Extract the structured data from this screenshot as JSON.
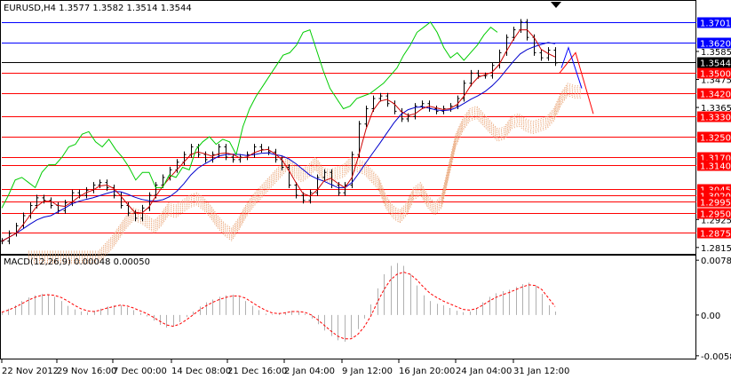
{
  "chart_data": [
    {
      "type": "candlestick",
      "title": "EURUSD,H4  1.3577 1.3582 1.3514 1.3544",
      "ylim": [
        1.279,
        1.378
      ],
      "y_ticks": [
        "1.3585",
        "1.3475",
        "1.3365",
        "1.2925",
        "1.2815"
      ],
      "levels": [
        {
          "label": "1.3701",
          "value": 1.3701,
          "color": "#0000ff",
          "box": "#0000ff"
        },
        {
          "label": "1.3620",
          "value": 1.362,
          "color": "#0000ff",
          "box": "#0000ff"
        },
        {
          "label": "1.3544",
          "value": 1.3544,
          "color": "#000000",
          "box": "#000000"
        },
        {
          "label": "1.3500",
          "value": 1.35,
          "color": "#ff0000",
          "box": "#ff0000"
        },
        {
          "label": "1.3420",
          "value": 1.342,
          "color": "#ff0000",
          "box": "#ff0000"
        },
        {
          "label": "1.3330",
          "value": 1.333,
          "color": "#ff0000",
          "box": "#ff0000"
        },
        {
          "label": "1.3250",
          "value": 1.325,
          "color": "#ff0000",
          "box": "#ff0000"
        },
        {
          "label": "1.3170",
          "value": 1.317,
          "color": "#ff0000",
          "box": "#ff0000"
        },
        {
          "label": "1.3140",
          "value": 1.314,
          "color": "#ff0000",
          "box": "#ff0000"
        },
        {
          "label": "1.3045",
          "value": 1.3045,
          "color": "#ff0000",
          "box": "#ff0000"
        },
        {
          "label": "1.3020",
          "value": 1.302,
          "color": "#ff0000",
          "box": "#ff0000"
        },
        {
          "label": "1.2995",
          "value": 1.2995,
          "color": "#ff0000",
          "box": "#ff0000"
        },
        {
          "label": "1.2950",
          "value": 1.295,
          "color": "#ff0000",
          "box": "#ff0000"
        },
        {
          "label": "1.2875",
          "value": 1.2875,
          "color": "#ff0000",
          "box": "#ff0000"
        }
      ],
      "close_series": [
        1.284,
        1.287,
        1.29,
        1.294,
        1.298,
        1.301,
        1.3,
        1.298,
        1.296,
        1.299,
        1.303,
        1.302,
        1.304,
        1.306,
        1.307,
        1.305,
        1.302,
        1.298,
        1.295,
        1.293,
        1.297,
        1.302,
        1.306,
        1.309,
        1.312,
        1.315,
        1.318,
        1.321,
        1.318,
        1.316,
        1.318,
        1.321,
        1.317,
        1.316,
        1.317,
        1.318,
        1.321,
        1.32,
        1.319,
        1.316,
        1.313,
        1.306,
        1.302,
        1.3,
        1.303,
        1.309,
        1.311,
        1.306,
        1.303,
        1.306,
        1.318,
        1.33,
        1.336,
        1.34,
        1.341,
        1.338,
        1.335,
        1.332,
        1.333,
        1.337,
        1.338,
        1.336,
        1.335,
        1.336,
        1.337,
        1.34,
        1.346,
        1.35,
        1.349,
        1.349,
        1.353,
        1.358,
        1.364,
        1.367,
        1.37,
        1.364,
        1.358,
        1.356,
        1.359,
        1.354
      ],
      "lagging_series": [
        1.297,
        1.302,
        1.308,
        1.309,
        1.307,
        1.305,
        1.311,
        1.314,
        1.314,
        1.317,
        1.321,
        1.322,
        1.326,
        1.327,
        1.323,
        1.321,
        1.324,
        1.32,
        1.317,
        1.313,
        1.308,
        1.311,
        1.311,
        1.305,
        1.305,
        1.31,
        1.309,
        1.313,
        1.312,
        1.32,
        1.323,
        1.325,
        1.322,
        1.324,
        1.323,
        1.318,
        1.329,
        1.336,
        1.341,
        1.345,
        1.349,
        1.353,
        1.357,
        1.358,
        1.361,
        1.366,
        1.367,
        1.359,
        1.351,
        1.344,
        1.34,
        1.336,
        1.337,
        1.34,
        1.341,
        1.342,
        1.344,
        1.346,
        1.349,
        1.352,
        1.357,
        1.361,
        1.366,
        1.368,
        1.37,
        1.366,
        1.36,
        1.356,
        1.358,
        1.355,
        1.358,
        1.361,
        1.365,
        1.368,
        1.366
      ],
      "x_tick_labels": [
        "22 Nov 2012",
        "29 Nov 16:00",
        "7 Dec 00:00",
        "14 Dec 08:00",
        "21 Dec 16:00",
        "2 Jan 04:00",
        "9 Jan 12:00",
        "16 Jan 20:00",
        "24 Jan 04:00",
        "31 Jan 12:00"
      ]
    },
    {
      "type": "bar",
      "title": "MACD(12,26,9) 0.00048 0.00050",
      "ylim": [
        -0.0062,
        0.0082
      ],
      "y_ticks": [
        "0.0078",
        "0.00",
        "-0.0058"
      ],
      "histogram": [
        0.0005,
        0.0009,
        0.0014,
        0.002,
        0.0025,
        0.0028,
        0.003,
        0.0029,
        0.0026,
        0.002,
        0.0013,
        0.0008,
        0.0005,
        0.0004,
        0.0006,
        0.0009,
        0.0012,
        0.0014,
        0.0014,
        0.0011,
        0.0007,
        0.0003,
        -0.0002,
        -0.0008,
        -0.0014,
        -0.0018,
        -0.0016,
        -0.001,
        -0.0003,
        0.0005,
        0.0012,
        0.0018,
        0.0022,
        0.0026,
        0.0028,
        0.0029,
        0.0026,
        0.002,
        0.0013,
        0.0007,
        0.0002,
        0.0001,
        0.0002,
        0.0004,
        0.0006,
        0.0005,
        0.0002,
        -0.0005,
        -0.0013,
        -0.0022,
        -0.003,
        -0.0036,
        -0.0038,
        -0.0032,
        -0.002,
        -0.0005,
        0.0015,
        0.0038,
        0.0058,
        0.007,
        0.0074,
        0.007,
        0.0058,
        0.0042,
        0.0028,
        0.002,
        0.0016,
        0.0014,
        0.001,
        0.0006,
        0.0004,
        0.0005,
        0.001,
        0.0018,
        0.0026,
        0.0031,
        0.0034,
        0.0036,
        0.004,
        0.0044,
        0.0046,
        0.0042,
        0.003,
        0.0014,
        0.0005
      ],
      "signal": [
        0.0004,
        0.0007,
        0.0011,
        0.0016,
        0.0021,
        0.0025,
        0.0028,
        0.0029,
        0.0028,
        0.0025,
        0.002,
        0.0014,
        0.0009,
        0.0006,
        0.0005,
        0.0007,
        0.001,
        0.0012,
        0.0014,
        0.0013,
        0.001,
        0.0006,
        0.0002,
        -0.0003,
        -0.0009,
        -0.0014,
        -0.0016,
        -0.0013,
        -0.0007,
        0.0,
        0.0007,
        0.0013,
        0.0018,
        0.0022,
        0.0025,
        0.0027,
        0.0027,
        0.0024,
        0.0018,
        0.0012,
        0.0007,
        0.0003,
        0.0002,
        0.0003,
        0.0005,
        0.0005,
        0.0004,
        0.0,
        -0.0007,
        -0.0015,
        -0.0023,
        -0.003,
        -0.0034,
        -0.0034,
        -0.0028,
        -0.0017,
        -0.0002,
        0.0018,
        0.0036,
        0.005,
        0.0058,
        0.0061,
        0.0058,
        0.005,
        0.004,
        0.0031,
        0.0025,
        0.002,
        0.0016,
        0.0012,
        0.0008,
        0.0007,
        0.0009,
        0.0014,
        0.002,
        0.0025,
        0.0029,
        0.0032,
        0.0036,
        0.004,
        0.0043,
        0.0042,
        0.0036,
        0.0024,
        0.0012
      ]
    }
  ],
  "ui": {
    "indicator_triangle": "triangle-down-icon",
    "colors": {
      "candle": "#000000",
      "kijun": "#0000cc",
      "tenkan": "#cc0000",
      "chikou": "#00cc00",
      "cloud": "#e8a070",
      "macd_hist": "#b0b0b0",
      "macd_signal": "#ff0000"
    }
  }
}
